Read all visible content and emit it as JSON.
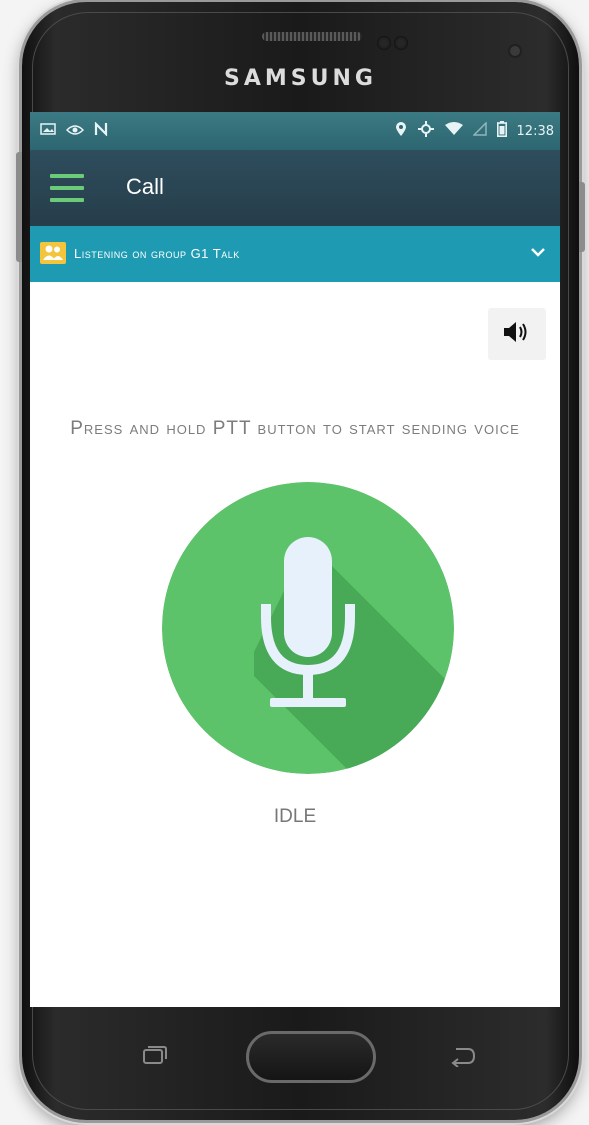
{
  "device": {
    "brand": "SAMSUNG"
  },
  "status_bar": {
    "left_icons": [
      "image-notification-icon",
      "eye-icon",
      "nfc-icon"
    ],
    "right_icons": [
      "location-icon",
      "sync-icon",
      "wifi-icon",
      "signal-icon",
      "battery-icon"
    ],
    "time": "12:38"
  },
  "app_bar": {
    "title": "Call",
    "menu_icon": "hamburger-menu-icon"
  },
  "group_bar": {
    "icon": "group-icon",
    "label": "Listening on group G1 Talk",
    "dropdown_icon": "chevron-down-icon"
  },
  "speaker_button": {
    "icon": "speaker-volume-icon"
  },
  "main": {
    "instruction": "Press and hold PTT button to start sending voice",
    "ptt_icon": "microphone-icon",
    "status": "IDLE"
  },
  "colors": {
    "status_bar": "#2d6670",
    "app_bar": "#2a4554",
    "group_bar": "#1e9bb3",
    "ptt_green": "#5cc36a",
    "ptt_shadow": "#46a654",
    "mic_fill": "#e6f1fb",
    "hamburger": "#6ccb78"
  },
  "nav_keys": {
    "recent": "recent-apps-icon",
    "home": "home-button",
    "back": "back-icon"
  }
}
